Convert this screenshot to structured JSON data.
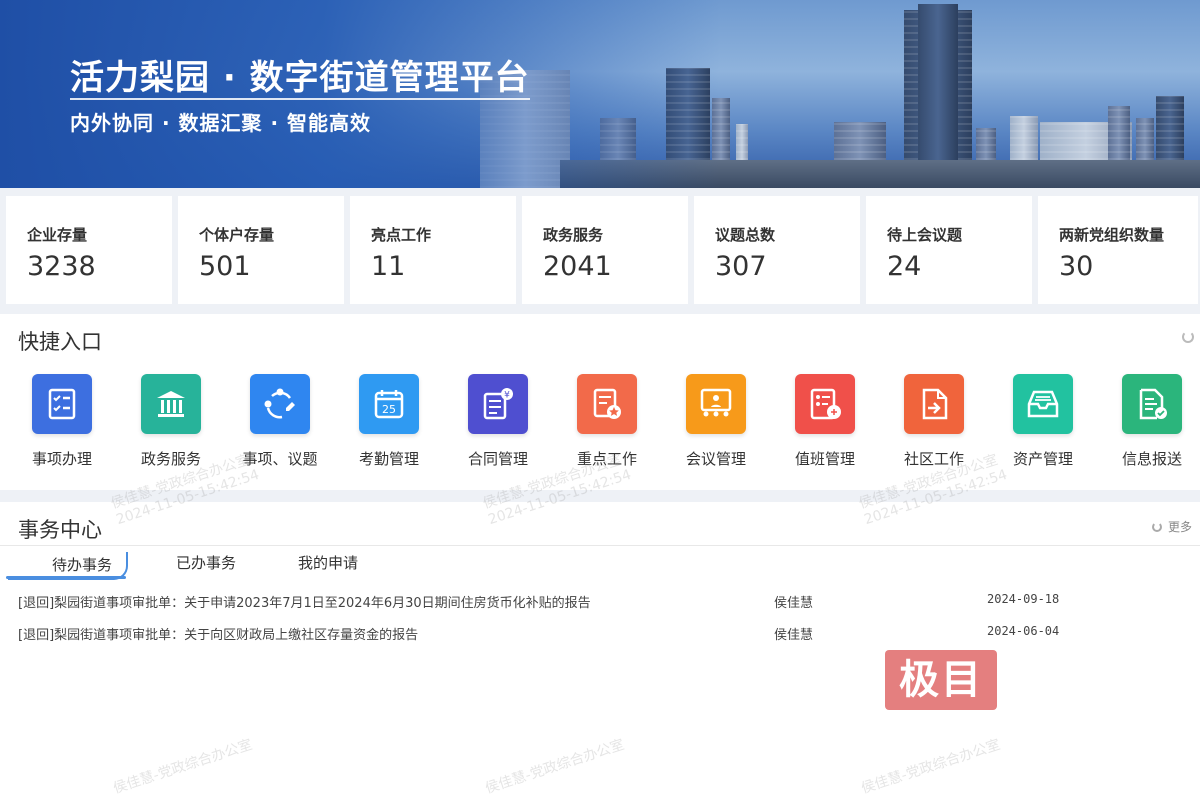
{
  "banner": {
    "title": "活力梨园 · 数字街道管理平台",
    "subtitle": "内外协同 · 数据汇聚 · 智能高效"
  },
  "stats": [
    {
      "label": "企业存量",
      "value": "3238"
    },
    {
      "label": "个体户存量",
      "value": "501"
    },
    {
      "label": "亮点工作",
      "value": "11"
    },
    {
      "label": "政务服务",
      "value": "2041"
    },
    {
      "label": "议题总数",
      "value": "307"
    },
    {
      "label": "待上会议题",
      "value": "24"
    },
    {
      "label": "两新党组织数量",
      "value": "30"
    }
  ],
  "quick_entry": {
    "title": "快捷入口",
    "items": [
      {
        "label": "事项办理",
        "icon": "checklist-icon",
        "color": "#3d6fe0"
      },
      {
        "label": "政务服务",
        "icon": "government-building-icon",
        "color": "#27b39a"
      },
      {
        "label": "事项、议题",
        "icon": "network-topic-icon",
        "color": "#2f86f0"
      },
      {
        "label": "考勤管理",
        "icon": "calendar-icon",
        "color": "#2f9af2"
      },
      {
        "label": "合同管理",
        "icon": "contract-icon",
        "color": "#4f4fd0"
      },
      {
        "label": "重点工作",
        "icon": "key-task-icon",
        "color": "#f26a4a"
      },
      {
        "label": "会议管理",
        "icon": "meeting-icon",
        "color": "#f79a1a"
      },
      {
        "label": "值班管理",
        "icon": "duty-roster-icon",
        "color": "#f0504a"
      },
      {
        "label": "社区工作",
        "icon": "community-document-icon",
        "color": "#f0643c"
      },
      {
        "label": "资产管理",
        "icon": "asset-tray-icon",
        "color": "#22c2a0"
      },
      {
        "label": "信息报送",
        "icon": "report-document-icon",
        "color": "#2bb57c"
      }
    ]
  },
  "affairs": {
    "title": "事务中心",
    "more_label": "更多",
    "tabs": [
      "待办事务",
      "已办事务",
      "我的申请"
    ],
    "rows": [
      {
        "title": "[退回]梨园街道事项审批单：关于申请2023年7月1日至2024年6月30日期间住房货币化补贴的报告",
        "person": "侯佳慧",
        "date": "2024-09-18"
      },
      {
        "title": "[退回]梨园街道事项审批单：关于向区财政局上缴社区存量资金的报告",
        "person": "侯佳慧",
        "date": "2024-06-04"
      }
    ]
  },
  "watermark": {
    "text": "侯佳慧-党政综合办公室",
    "time": "2024-11-05-15:42:54"
  },
  "logo_text": "极目"
}
